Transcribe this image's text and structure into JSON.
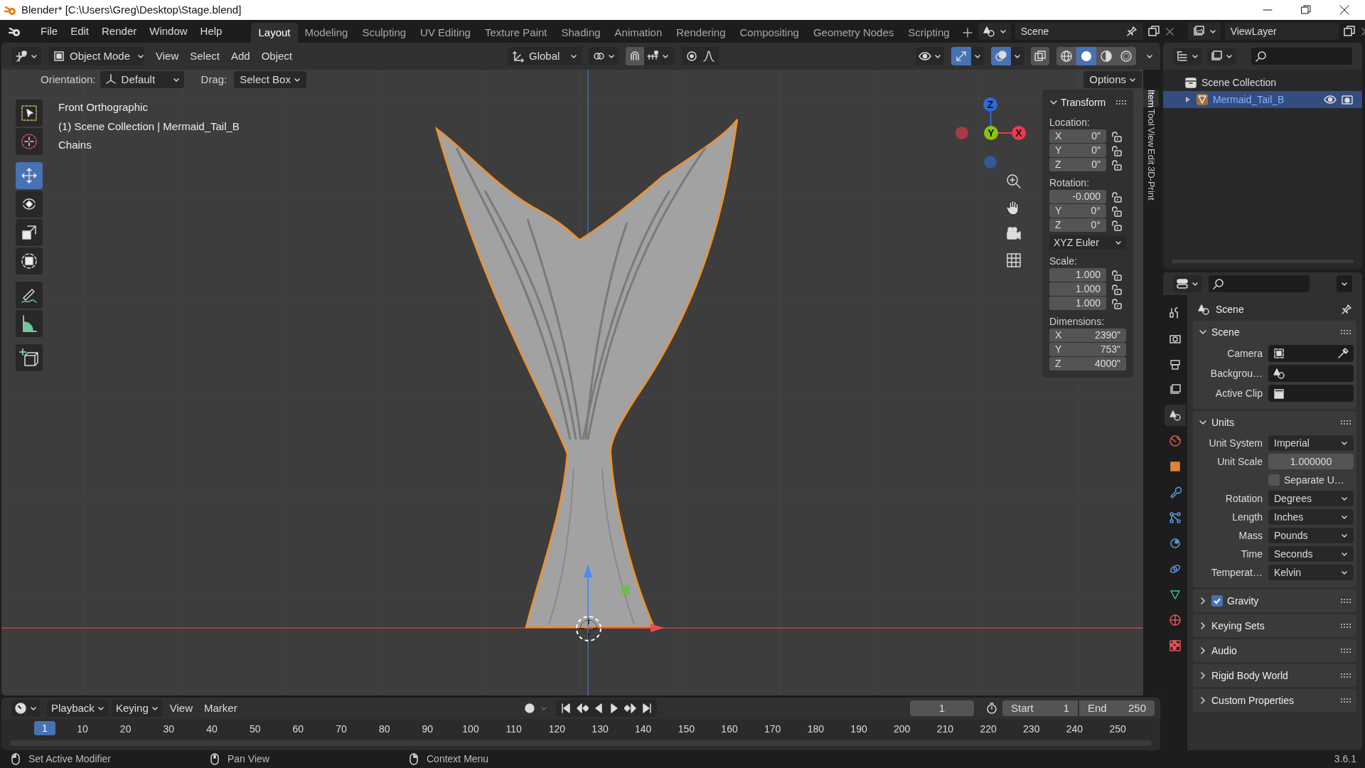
{
  "window": {
    "title": "Blender* [C:\\Users\\Greg\\Desktop\\Stage.blend]"
  },
  "menus": [
    "File",
    "Edit",
    "Render",
    "Window",
    "Help"
  ],
  "workspaces": [
    {
      "label": "Layout",
      "selected": true
    },
    {
      "label": "Modeling",
      "selected": false
    },
    {
      "label": "Sculpting",
      "selected": false
    },
    {
      "label": "UV Editing",
      "selected": false
    },
    {
      "label": "Texture Paint",
      "selected": false
    },
    {
      "label": "Shading",
      "selected": false
    },
    {
      "label": "Animation",
      "selected": false
    },
    {
      "label": "Rendering",
      "selected": false
    },
    {
      "label": "Compositing",
      "selected": false
    },
    {
      "label": "Geometry Nodes",
      "selected": false
    },
    {
      "label": "Scripting",
      "selected": false
    }
  ],
  "scene": "Scene",
  "view_layer": "ViewLayer",
  "viewport_header": {
    "mode": "Object Mode",
    "menus": [
      "View",
      "Select",
      "Add",
      "Object"
    ],
    "orientation": "Global",
    "gizmos": true,
    "overlays": true,
    "shading": [
      {
        "kind": "wireframe",
        "selected": false
      },
      {
        "kind": "solid",
        "selected": true
      },
      {
        "kind": "material",
        "selected": false
      },
      {
        "kind": "rendered",
        "selected": false
      }
    ]
  },
  "tool_settings": {
    "orientation_label": "Orientation:",
    "orientation": "Default",
    "drag_label": "Drag:",
    "drag": "Select Box",
    "options": "Options"
  },
  "tools": [
    {
      "kind": "select_box",
      "selected": false
    },
    {
      "kind": "cursor",
      "selected": false
    },
    {
      "kind": "move",
      "selected": true
    },
    {
      "kind": "rotate",
      "selected": false
    },
    {
      "kind": "scale",
      "selected": false
    },
    {
      "kind": "transform",
      "selected": false
    },
    {
      "kind": "annotate",
      "selected": false
    },
    {
      "kind": "measure",
      "selected": false
    },
    {
      "kind": "add_cube",
      "selected": false
    }
  ],
  "viewport_text": [
    "Front Orthographic",
    "(1) Scene Collection | Mermaid_Tail_B",
    "Chains"
  ],
  "navigation_gizmo": [
    {
      "label": "Z",
      "color": "#2f6bd6"
    },
    {
      "label": "Y",
      "color": "#8bc40e"
    },
    {
      "label": "X",
      "color": "#f0384f"
    }
  ],
  "sidebar": {
    "tabs": [
      {
        "label": "Item",
        "selected": true
      },
      {
        "label": "Tool",
        "selected": false
      },
      {
        "label": "View",
        "selected": false
      },
      {
        "label": "Edit",
        "selected": false
      },
      {
        "label": "3D-Print",
        "selected": false
      }
    ],
    "panel_title": "Transform",
    "groups": [
      {
        "label": "Location:",
        "locks": true,
        "fields": [
          {
            "axis": "X",
            "value": "0\""
          },
          {
            "axis": "Y",
            "value": "0\""
          },
          {
            "axis": "Z",
            "value": "0\""
          }
        ]
      },
      {
        "label": "Rotation:",
        "locks": true,
        "fields": [
          {
            "value": "-0.000"
          },
          {
            "axis": "Y",
            "value": "0°"
          },
          {
            "axis": "Z",
            "value": "0°"
          }
        ],
        "dropdown": "XYZ Euler"
      },
      {
        "label": "Scale:",
        "locks": true,
        "fields": [
          {
            "value": "1.000"
          },
          {
            "value": "1.000"
          },
          {
            "value": "1.000"
          }
        ]
      },
      {
        "label": "Dimensions:",
        "locks": false,
        "fields": [
          {
            "axis": "X",
            "value": "2390\""
          },
          {
            "axis": "Y",
            "value": "753\""
          },
          {
            "axis": "Z",
            "value": "4000\""
          }
        ]
      }
    ]
  },
  "outliner": {
    "items": [
      {
        "label": "Scene Collection",
        "selected": false,
        "children": [
          {
            "label": "Mermaid_Tail_B",
            "selected": true,
            "expanded": false
          }
        ]
      }
    ]
  },
  "properties": {
    "tabs": [
      {
        "kind": "tool",
        "selected": false
      },
      {
        "kind": "render",
        "selected": false
      },
      {
        "kind": "output",
        "selected": false
      },
      {
        "kind": "view_layer",
        "selected": false
      },
      {
        "kind": "scene",
        "selected": true
      },
      {
        "kind": "world",
        "selected": false
      },
      {
        "kind": "object",
        "selected": false
      },
      {
        "kind": "modifiers",
        "selected": false
      },
      {
        "kind": "particles",
        "selected": false
      },
      {
        "kind": "physics",
        "selected": false
      },
      {
        "kind": "constraints",
        "selected": false
      },
      {
        "kind": "data",
        "selected": false
      },
      {
        "kind": "material",
        "selected": false
      },
      {
        "kind": "texture",
        "selected": false
      }
    ],
    "context": "Scene",
    "panels": [
      {
        "title": "Scene",
        "expanded": true,
        "rows": [
          {
            "kind": "camera",
            "label": "Camera"
          },
          {
            "kind": "scene",
            "label": "Backgrou…"
          },
          {
            "kind": "clip",
            "label": "Active Clip"
          }
        ]
      },
      {
        "title": "Units",
        "expanded": true,
        "rows": [
          {
            "kind": "dropdown",
            "label": "Unit System",
            "value": "Imperial"
          },
          {
            "kind": "number",
            "label": "Unit Scale",
            "value": "1.000000"
          },
          {
            "kind": "checkbox",
            "label": "Separate U…",
            "checked": false
          },
          {
            "kind": "dropdown",
            "label": "Rotation",
            "value": "Degrees"
          },
          {
            "kind": "dropdown",
            "label": "Length",
            "value": "Inches"
          },
          {
            "kind": "dropdown",
            "label": "Mass",
            "value": "Pounds"
          },
          {
            "kind": "dropdown",
            "label": "Time",
            "value": "Seconds"
          },
          {
            "kind": "dropdown",
            "label": "Temperat…",
            "value": "Kelvin"
          }
        ]
      },
      {
        "title": "Gravity",
        "expanded": false,
        "checked": true
      },
      {
        "title": "Keying Sets",
        "expanded": false
      },
      {
        "title": "Audio",
        "expanded": false
      },
      {
        "title": "Rigid Body World",
        "expanded": false
      },
      {
        "title": "Custom Properties",
        "expanded": false
      }
    ]
  },
  "timeline": {
    "menus": [
      "Playback",
      "Keying",
      "View",
      "Marker"
    ],
    "frame": "1",
    "start_label": "Start",
    "start": "1",
    "end_label": "End",
    "end": "250",
    "playhead": "1",
    "ticks": [
      "10",
      "20",
      "30",
      "40",
      "50",
      "60",
      "70",
      "80",
      "90",
      "100",
      "110",
      "120",
      "130",
      "140",
      "150",
      "160",
      "170",
      "180",
      "190",
      "200",
      "210",
      "220",
      "230",
      "240",
      "250"
    ]
  },
  "status_bar": [
    "Set Active Modifier",
    "Pan View",
    "Context Menu"
  ],
  "version": "3.6.1"
}
